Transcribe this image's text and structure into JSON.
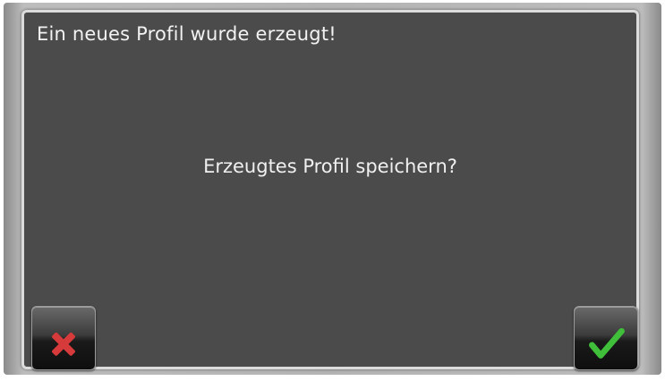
{
  "dialog": {
    "title": "Ein neues Profil wurde erzeugt!",
    "message": "Erzeugtes Profil speichern?"
  },
  "buttons": {
    "cancel": {
      "icon": "cross-icon",
      "color": "#d63a3a"
    },
    "confirm": {
      "icon": "checkmark-icon",
      "color": "#3fbf3a"
    }
  }
}
